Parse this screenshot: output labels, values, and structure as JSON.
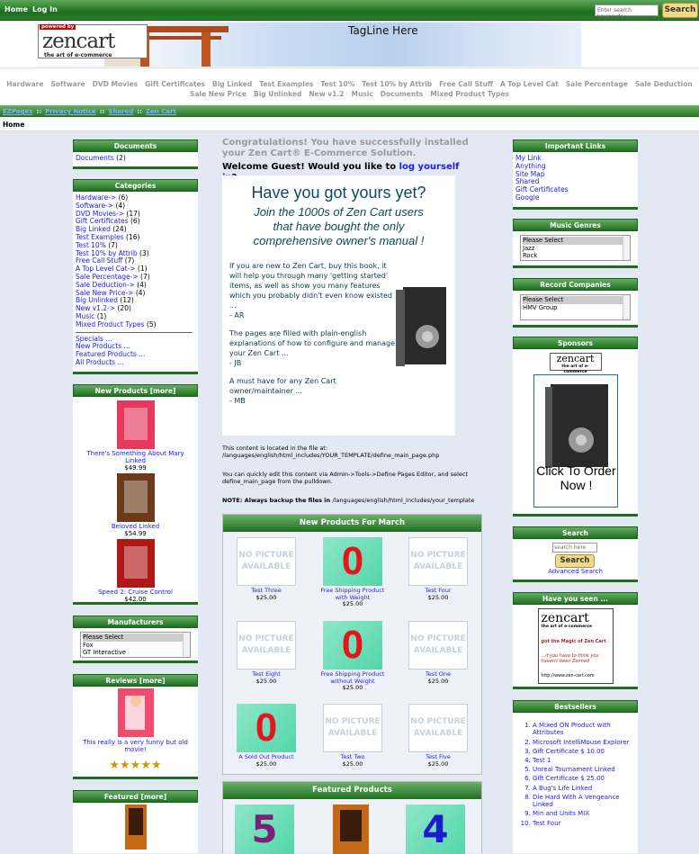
{
  "topbar": {
    "home": "Home",
    "login": "Log In",
    "search_placeholder": "Enter search keywords",
    "search_button": "Search"
  },
  "header": {
    "logo_powered": "powered by",
    "logo_zen": "zen",
    "logo_cart": "cart",
    "logo_tagline": "the art of e-commerce",
    "tagline": "TagLine Here"
  },
  "categories_bar": {
    "row1": [
      "Hardware",
      "Software",
      "DVD Movies",
      "Gift Certificates",
      "Big Linked",
      "Test Examples",
      "Test 10%",
      "Test 10% by Attrib",
      "Free Call Stuff",
      "A Top Level Cat",
      "Sale Percentage",
      "Sale Deduction"
    ],
    "row2": [
      "Sale New Price",
      "Big Unlinked",
      "New v1.2",
      "Music",
      "Documents",
      "Mixed Product Types"
    ]
  },
  "ezpages": {
    "items": [
      "EZPages",
      "Privacy Notice",
      "Shared",
      "Zen Cart"
    ],
    "sep": "::"
  },
  "breadcrumb": "Home",
  "left": {
    "documents": {
      "title": "Documents",
      "link": "Documents",
      "count": "(2)"
    },
    "categories": {
      "title": "Categories",
      "items": [
        [
          "Hardware->",
          "(6)"
        ],
        [
          "Software->",
          "(4)"
        ],
        [
          "DVD Movies->",
          "(17)"
        ],
        [
          "Gift Certificates",
          "(6)"
        ],
        [
          "Big Linked",
          "(24)"
        ],
        [
          "Test Examples",
          "(16)"
        ],
        [
          "Test 10%",
          "(7)"
        ],
        [
          "Test 10% by Attrib",
          "(3)"
        ],
        [
          "Free Call Stuff",
          "(7)"
        ],
        [
          "A Top Level Cat->",
          "(1)"
        ],
        [
          "Sale Percentage->",
          "(7)"
        ],
        [
          "Sale Deduction->",
          "(4)"
        ],
        [
          "Sale New Price->",
          "(4)"
        ],
        [
          "Big Unlinked",
          "(12)"
        ],
        [
          "New v1.2->",
          "(20)"
        ],
        [
          "Music",
          "(1)"
        ],
        [
          "Mixed Product Types",
          "(5)"
        ]
      ],
      "extra": [
        "Specials ...",
        "New Products ...",
        "Featured Products ...",
        "All Products ..."
      ]
    },
    "new_products": {
      "title": "New Products  [more]",
      "items": [
        {
          "name": "There's Something About Mary Linked",
          "price": "$49.99"
        },
        {
          "name": "Beloved Linked",
          "price": "$54.99"
        },
        {
          "name": "Speed 2: Cruise Control",
          "price": "$42.00"
        }
      ]
    },
    "manufacturers": {
      "title": "Manufacturers",
      "options": [
        "Please Select",
        "Fox",
        "GT Interactive"
      ]
    },
    "reviews": {
      "title": "Reviews  [more]",
      "text": "This really is a very funny but old movie!",
      "stars": "★★★★★"
    },
    "featured": {
      "title": "Featured  [more]"
    }
  },
  "center": {
    "congrats": "Congratulations! You have successfully installed your Zen Cart® E-Commerce Solution.",
    "welcome_pre": "Welcome Guest! Would you like to ",
    "welcome_link": "log yourself in",
    "welcome_post": "?",
    "promo": {
      "headline": "Have you got yours yet?",
      "sub1": "Join the 1000s of Zen Cart users",
      "sub2": "that have bought the only",
      "sub3": "comprehensive owner's manual !",
      "p1": "If you are new to Zen Cart, buy this book, it will help you through many 'getting started' items, as well as show you many features which you probably didn't even know existed ...",
      "s1": "- AR",
      "p2": "The pages are filled with plain-english explanations of how to configure and manage your Zen Cart ...",
      "s2": "- JB",
      "p3": "A must have for any Zen Cart owner/maintainer ...",
      "s3": "- MB",
      "book_title": "e-Start Your Web Store with Zen Cart"
    },
    "info1": "This content is located in the file at: /languages/english/html_includes/YOUR_TEMPLATE/define_main_page.php",
    "info2": "You can quickly edit this content via Admin->Tools->Define Pages Editor, and select define_main_page from the pulldown.",
    "info3_bold": "NOTE: Always backup the files in ",
    "info3_rest": "/languages/english/html_includes/your_template",
    "new_products_title": "New Products For March",
    "no_picture": "NO PICTURE AVAILABLE",
    "grid": [
      {
        "name": "Test Three",
        "price": "$25.00",
        "img": "np"
      },
      {
        "name": "Free Shipping Product with Weight",
        "price": "$25.00",
        "img": "zero"
      },
      {
        "name": "Test Four",
        "price": "$25.00",
        "img": "np"
      },
      {
        "name": "Test Eight",
        "price": "$25.00",
        "img": "np"
      },
      {
        "name": "Free Shipping Product without Weight",
        "price": "$25.00",
        "img": "zero"
      },
      {
        "name": "Test One",
        "price": "$25.00",
        "img": "np"
      },
      {
        "name": "A Sold Out Product",
        "price": "$25.00",
        "img": "zero"
      },
      {
        "name": "Test Two",
        "price": "$25.00",
        "img": "np"
      },
      {
        "name": "Test Five",
        "price": "$25.00",
        "img": "np"
      }
    ],
    "zero_digit": "0",
    "featured_title": "Featured Products",
    "featured_digits": [
      "5",
      "4"
    ]
  },
  "right": {
    "important": {
      "title": "Important Links",
      "items": [
        "My Link",
        "Anything",
        "Site Map",
        "Shared",
        "Gift Certificates",
        "Google"
      ]
    },
    "genres": {
      "title": "Music Genres",
      "options": [
        "Please Select",
        "Jazz",
        "Rock"
      ]
    },
    "record": {
      "title": "Record Companies",
      "options": [
        "Please Select",
        "HMV Group"
      ]
    },
    "sponsors": {
      "title": "Sponsors",
      "click": "Click To Order Now !"
    },
    "search": {
      "title": "Search",
      "placeholder": "search here",
      "button": "Search",
      "advanced": "Advanced Search"
    },
    "seen": {
      "title": "Have you seen ...",
      "magic": "got the Magic of Zen Cart",
      "think": "...if you have to think you haven't been Zenned",
      "url": "http://www.zen-cart.com"
    },
    "bestsellers": {
      "title": "Bestsellers",
      "items": [
        "A Mixed ON Product with Attributes",
        "Microsoft IntelliMouse Explorer",
        "Gift Certificate $ 10.00",
        "Test 1",
        "Unreal Tournament Linked",
        "Gift Certificate $ 25.00",
        "A Bug's Life Linked",
        "Die Hard With A Vengeance Linked",
        "Min and Units MIX",
        "Test Four"
      ]
    }
  },
  "colors": {
    "green": "#1f7021",
    "link": "#1a1aff",
    "accent_red": "#e3161d"
  }
}
